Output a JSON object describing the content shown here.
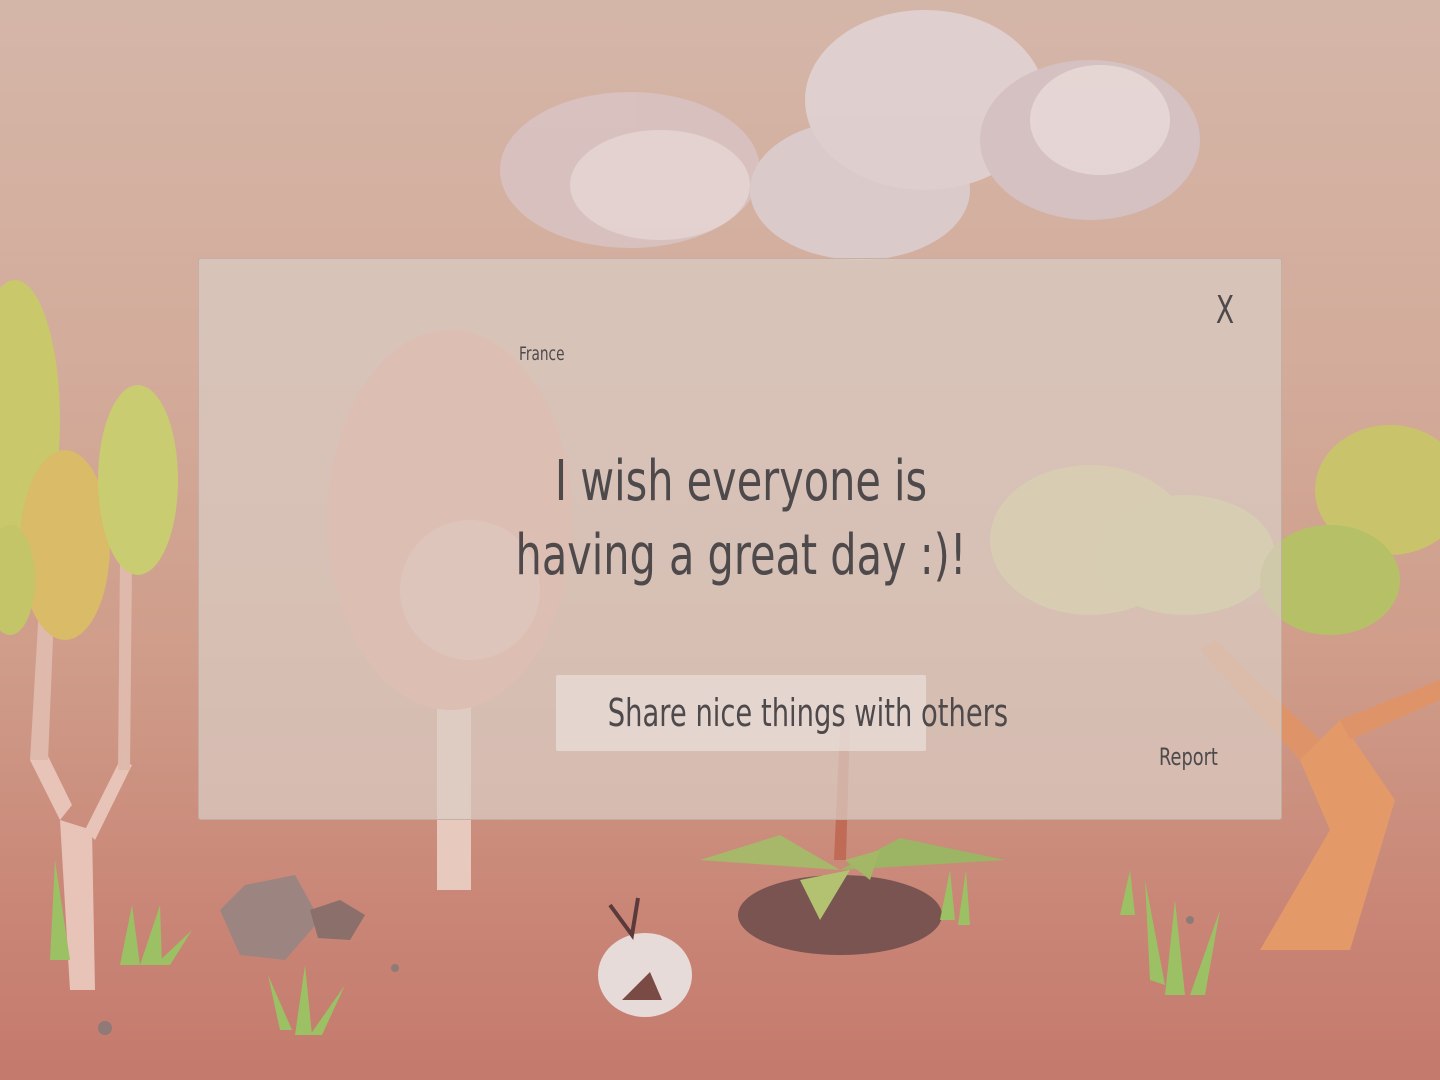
{
  "scene": {
    "sky_color": "#d4b6a8",
    "ground_color": "#c47a6c"
  },
  "modal": {
    "country": "France",
    "message": "I wish everyone is having a great day :)!",
    "share_label": "Share nice things with others",
    "report_label": "Report",
    "close_label": "X"
  }
}
